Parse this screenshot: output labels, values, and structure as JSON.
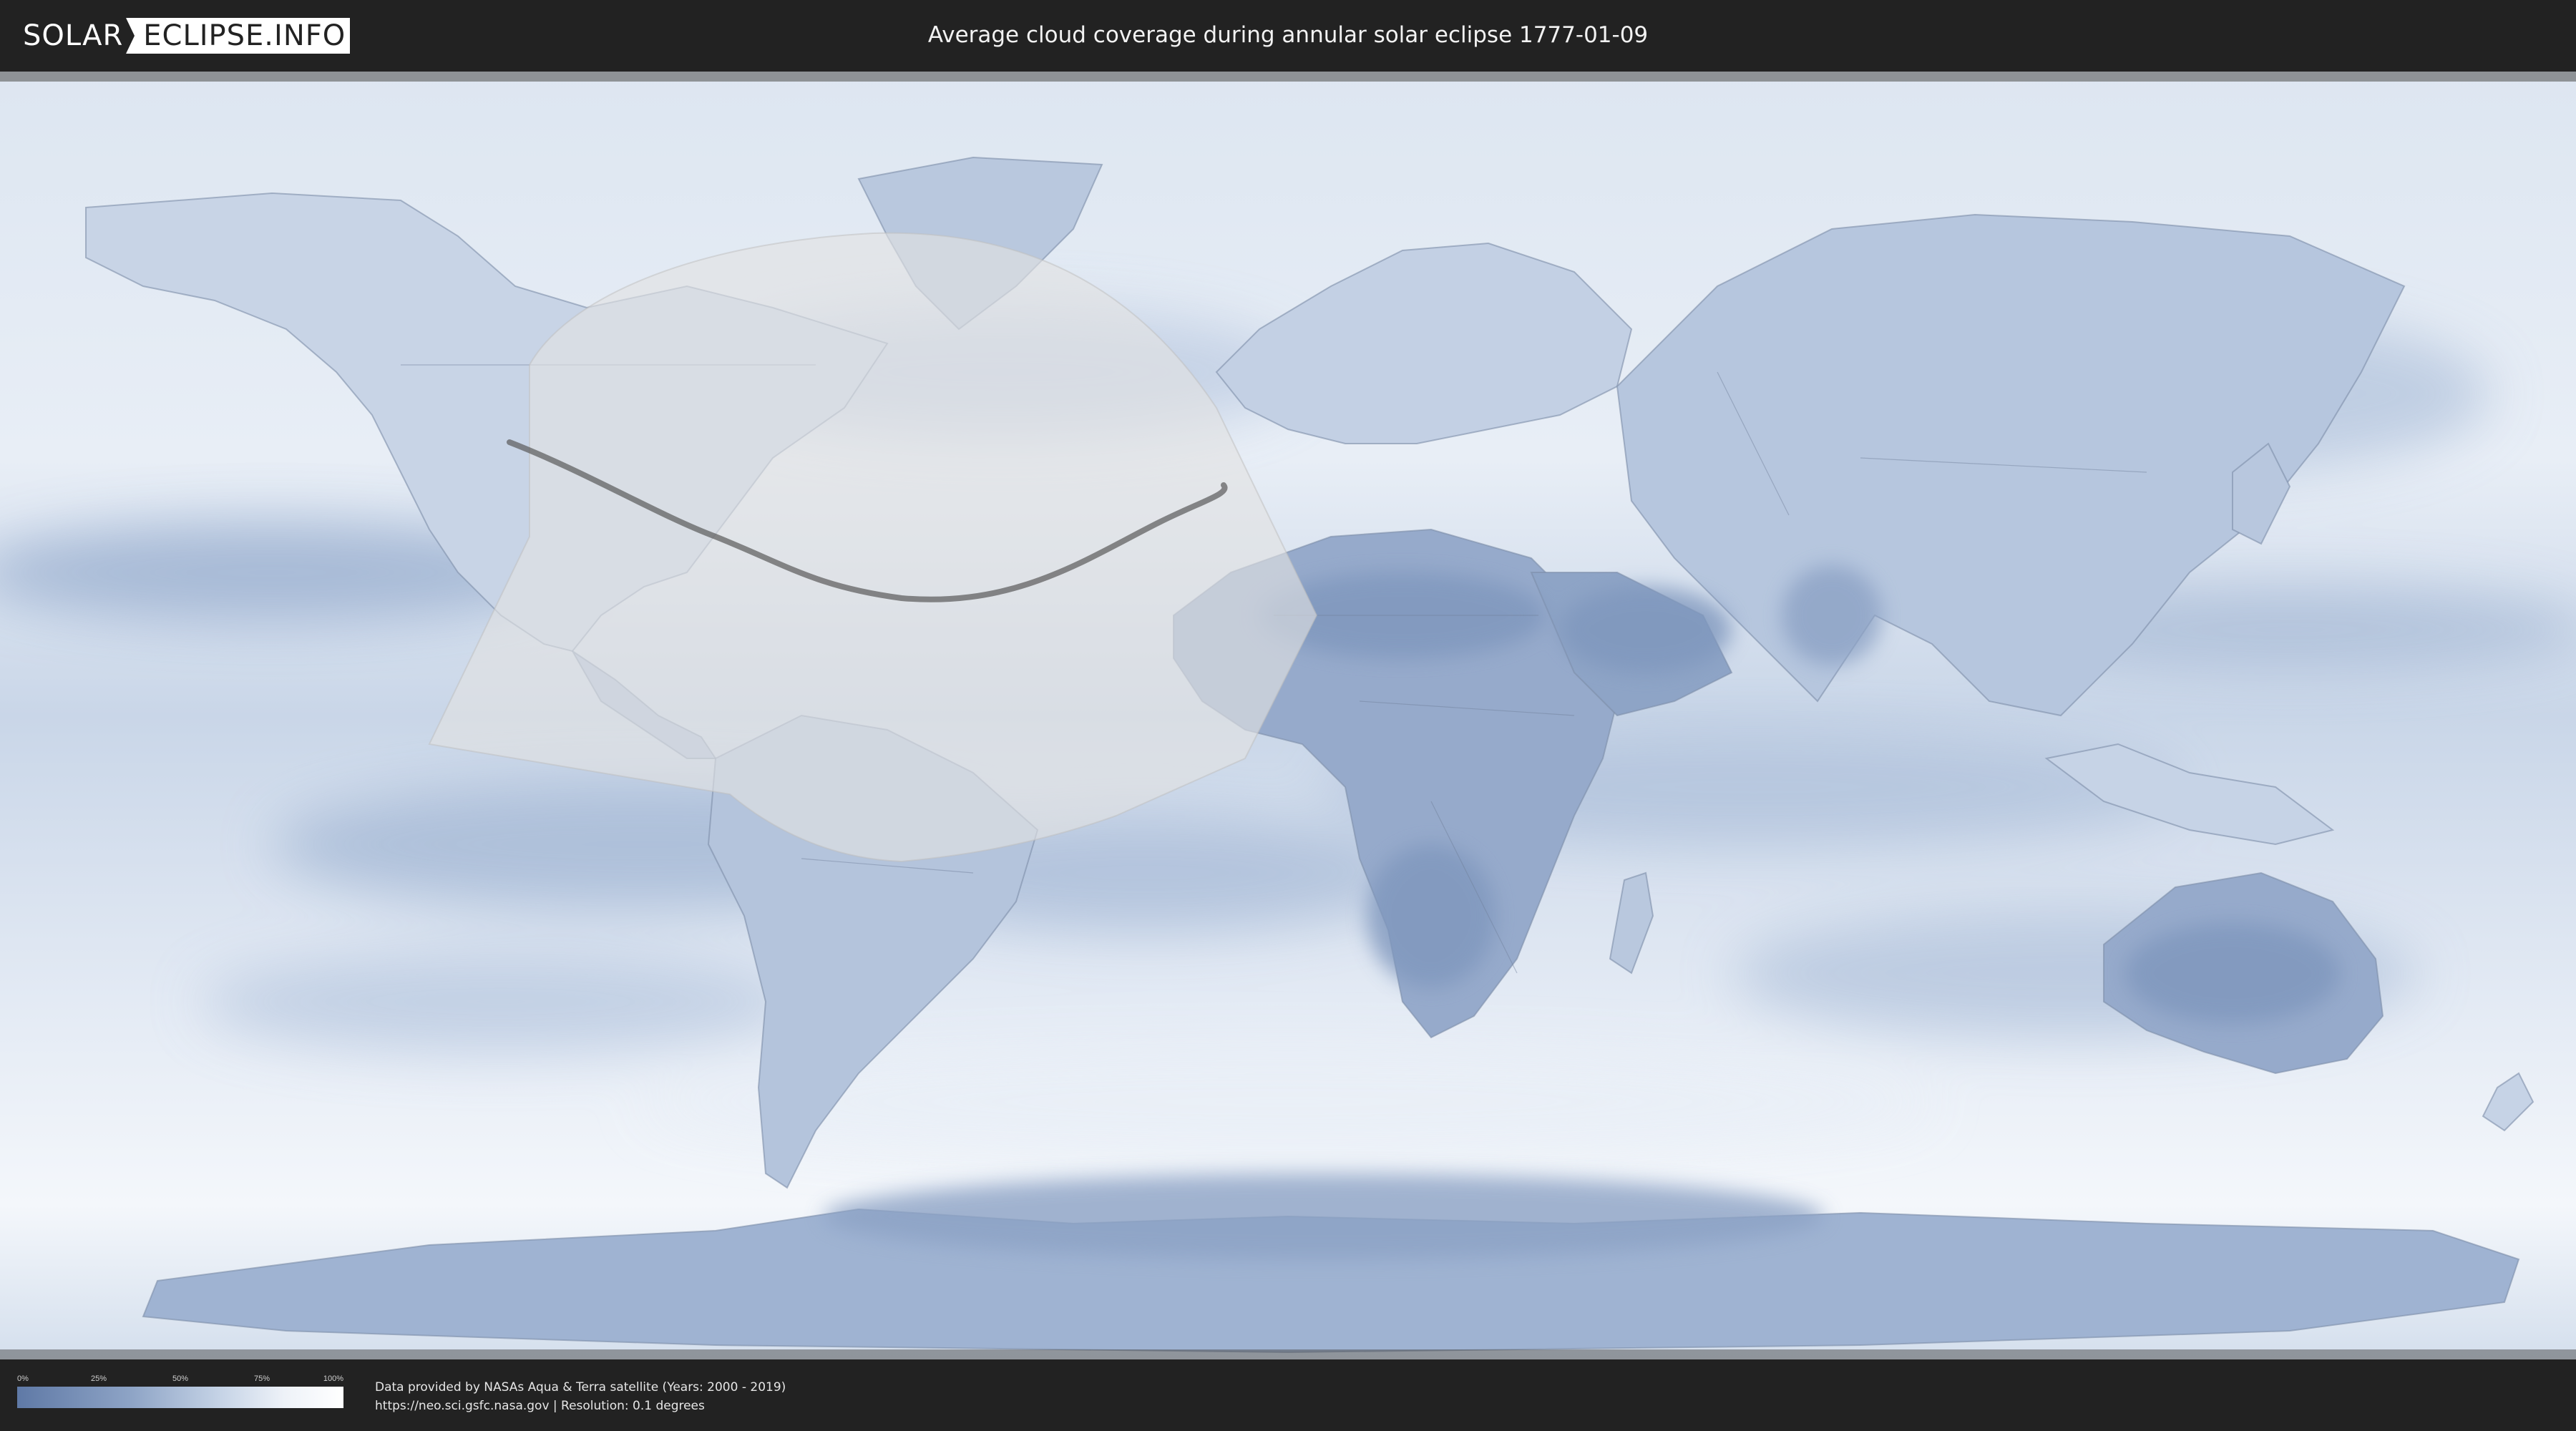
{
  "header": {
    "logo_left": "SOLAR",
    "logo_right": "ECLIPSE.INFO",
    "title": "Average cloud coverage during annular solar eclipse 1777-01-09"
  },
  "legend": {
    "ticks": [
      "0%",
      "25%",
      "50%",
      "75%",
      "100%"
    ],
    "colors": {
      "low": "#5f79a6",
      "high": "#ffffff"
    }
  },
  "footer": {
    "credit_line_1": "Data provided by NASAs Aqua & Terra satellite (Years: 2000 - 2019)",
    "credit_line_2": "https://neo.sci.gsfc.nasa.gov | Resolution: 0.1 degrees"
  },
  "map": {
    "projection": "equirectangular",
    "colors": {
      "clear": "#6c88b3",
      "cloudy": "#ffffff",
      "eclipse_zone": "#e6e6e6",
      "path": "#5a5a5a"
    }
  }
}
